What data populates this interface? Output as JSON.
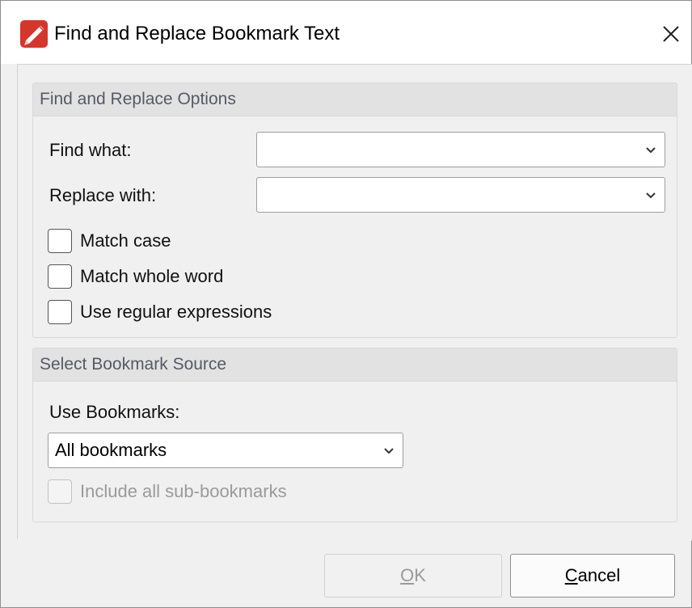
{
  "window": {
    "title": "Find and Replace Bookmark Text",
    "app_icon": "pdf-xchange-icon",
    "close_icon": "close-icon",
    "accent_color": "#d5362b"
  },
  "find_replace_options": {
    "header": "Find and Replace Options",
    "find_label": "Find what:",
    "find_value": "",
    "replace_label": "Replace with:",
    "replace_value": "",
    "checkboxes": [
      {
        "label": "Match case",
        "checked": false
      },
      {
        "label": "Match whole word",
        "checked": false
      },
      {
        "label": "Use regular expressions",
        "checked": false
      }
    ]
  },
  "bookmark_source": {
    "header": "Select Bookmark Source",
    "use_label": "Use Bookmarks:",
    "selected": "All bookmarks",
    "include_sub": {
      "label": "Include all sub-bookmarks",
      "checked": false,
      "enabled": false
    }
  },
  "buttons": {
    "ok_accel": "O",
    "ok_rest": "K",
    "ok_enabled": false,
    "cancel_accel": "C",
    "cancel_rest": "ancel"
  }
}
